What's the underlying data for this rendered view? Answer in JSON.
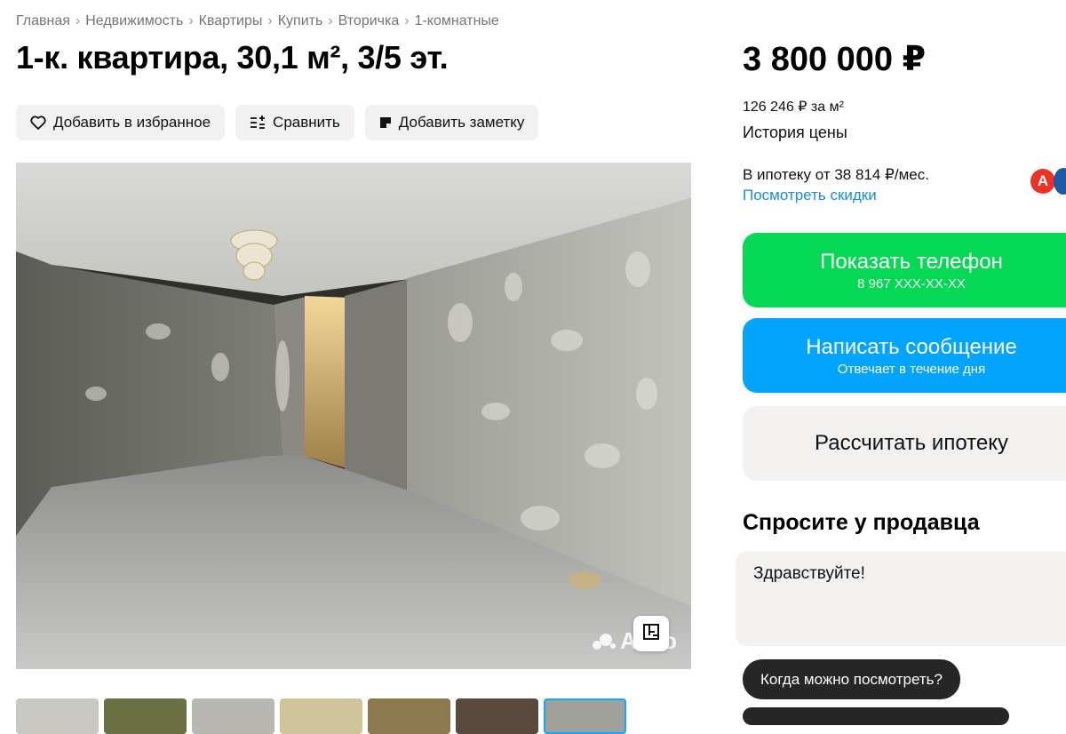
{
  "breadcrumbs": [
    "Главная",
    "Недвижимость",
    "Квартиры",
    "Купить",
    "Вторичка",
    "1-комнатные"
  ],
  "title": "1-к. квартира, 30,1 м², 3/5 эт.",
  "actions": {
    "favorite": "Добавить в избранное",
    "compare": "Сравнить",
    "note": "Добавить заметку"
  },
  "gallery": {
    "watermark": "Avito",
    "thumbnail_count": 7,
    "active_thumbnail": 7
  },
  "price": {
    "total": "3 800 000 ₽",
    "per_m2": "126 246 ₽ за м²",
    "history_link": "История цены"
  },
  "mortgage": {
    "from": "В ипотеку от 38 814 ₽/мес.",
    "discounts_link": "Посмотреть скидки",
    "bank_letter": "А"
  },
  "contact": {
    "phone_button": "Показать телефон",
    "phone_masked": "8 967 XXX-XX-XX",
    "message_button": "Написать сообщение",
    "message_sub": "Отвечает в течение дня",
    "calc_button": "Рассчитать ипотеку"
  },
  "ask": {
    "title": "Спросите у продавца",
    "message": "Здравствуйте!",
    "quick_reply": "Когда можно посмотреть?"
  },
  "colors": {
    "green": "#04d854",
    "blue": "#02a4fd",
    "link": "#1a8dd9",
    "chip": "#262626"
  }
}
